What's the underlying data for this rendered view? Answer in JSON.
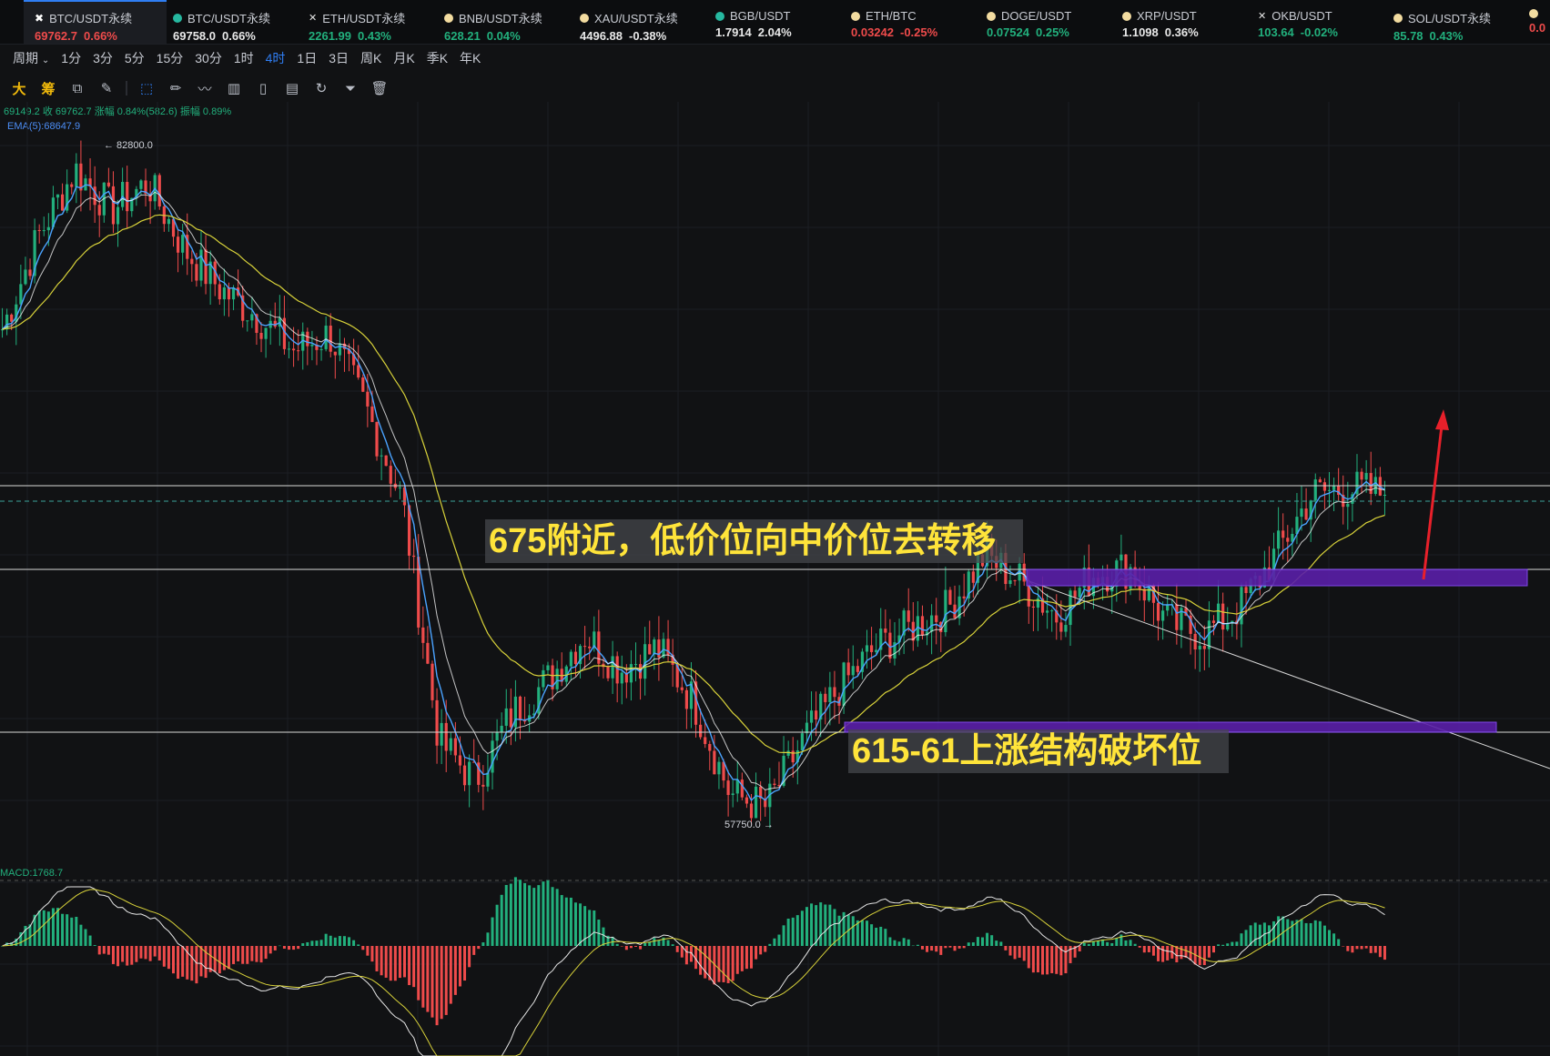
{
  "tickers": [
    {
      "pair": "BTC/USDT永续",
      "price": "69762.7",
      "change": "0.66%",
      "dir": "down",
      "icon": "btc-logo-icon",
      "active": true
    },
    {
      "pair": "BTC/USDT永续",
      "price": "69758.0",
      "change": "0.66%",
      "dir": "neutral",
      "icon": "green-coin-icon",
      "active": false
    },
    {
      "pair": "ETH/USDT永续",
      "price": "2261.99",
      "change": "0.43%",
      "dir": "up",
      "icon": "x-mark-icon",
      "active": false
    },
    {
      "pair": "BNB/USDT永续",
      "price": "628.21",
      "change": "0.04%",
      "dir": "up",
      "icon": "yellow-coin-icon",
      "active": false
    },
    {
      "pair": "XAU/USDT永续",
      "price": "4496.88",
      "change": "-0.38%",
      "dir": "neutral",
      "icon": "yellow-coin-icon",
      "active": false
    },
    {
      "pair": "BGB/USDT",
      "price": "1.7914",
      "change": "2.04%",
      "dir": "neutral",
      "icon": "green-coin-icon",
      "active": false
    },
    {
      "pair": "ETH/BTC",
      "price": "0.03242",
      "change": "-0.25%",
      "dir": "down",
      "icon": "yellow-coin-icon",
      "active": false
    },
    {
      "pair": "DOGE/USDT",
      "price": "0.07524",
      "change": "0.25%",
      "dir": "up",
      "icon": "yellow-coin-icon",
      "active": false
    },
    {
      "pair": "XRP/USDT",
      "price": "1.1098",
      "change": "0.36%",
      "dir": "neutral",
      "icon": "yellow-coin-icon",
      "active": false
    },
    {
      "pair": "OKB/USDT",
      "price": "103.64",
      "change": "-0.02%",
      "dir": "up",
      "icon": "x-mark-icon",
      "active": false
    },
    {
      "pair": "SOL/USDT永续",
      "price": "85.78",
      "change": "0.43%",
      "dir": "up",
      "icon": "yellow-coin-icon",
      "active": false
    },
    {
      "pair": "",
      "price": "0.0",
      "change": "",
      "dir": "down",
      "icon": "yellow-coin-icon",
      "active": false
    }
  ],
  "periods": {
    "label": "周期",
    "options": [
      "1分",
      "3分",
      "5分",
      "15分",
      "30分",
      "1时",
      "4时",
      "1日",
      "3日",
      "周K",
      "月K",
      "季K",
      "年K"
    ],
    "selected": "4时"
  },
  "tools": {
    "text_tools": [
      "大",
      "筹"
    ]
  },
  "indicators": {
    "info_line": "69149.2 收 69762.7 涨幅 0.84%(582.6) 振幅 0.89%",
    "ema_label": "EMA(5):68647.9",
    "macd_label": "MACD:1768.7"
  },
  "price_marks": {
    "high": "← 82800.0",
    "low": "57750.0 →"
  },
  "annotations": {
    "upper": "675附近，低价位向中价位去转移",
    "lower": "615-61上涨结构破坏位"
  },
  "colors": {
    "up": "#22b07d",
    "down": "#ef4b4b",
    "accent": "#2f7ef3",
    "annotation_text": "#ffe43a",
    "zone": "#5a1fa8",
    "arrow": "#e8202a"
  },
  "chart_data": {
    "type": "candlestick",
    "timeframe": "4时",
    "price_path": [
      76000,
      79500,
      82000,
      80500,
      81500,
      79000,
      77500,
      76500,
      75200,
      75800,
      73000,
      69500,
      60500,
      59000,
      61500,
      62800,
      64500,
      63200,
      64000,
      62000,
      58500,
      58000,
      60500,
      62500,
      64000,
      64800,
      65500,
      67500,
      66500,
      65200,
      66800,
      67000,
      65000,
      64500,
      65500,
      67500,
      69800,
      70000,
      69800
    ],
    "levels": {
      "high": 82800.0,
      "low": 57750.0,
      "last_close": 69762.7,
      "ema5": 68647.9
    },
    "macd": 1768.7
  }
}
